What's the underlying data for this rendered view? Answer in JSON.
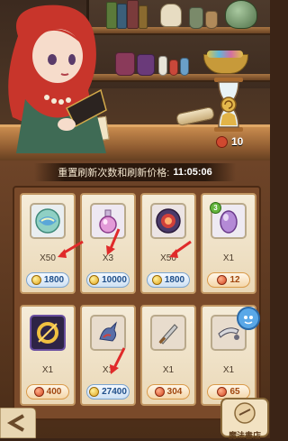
{
  "header": {
    "refresh_label": "重置刷新次数和刷新价格:",
    "refresh_time": "11:05:06",
    "refresh_count": "10"
  },
  "items": [
    {
      "name": "swirl-orb",
      "qty": "X50",
      "price": "1800",
      "currency": "coin"
    },
    {
      "name": "potion-flask",
      "qty": "X3",
      "price": "10000",
      "currency": "coin"
    },
    {
      "name": "red-rune-orb",
      "qty": "X50",
      "price": "1800",
      "currency": "coin"
    },
    {
      "name": "purple-egg",
      "qty": "X1",
      "price": "12",
      "currency": "gem",
      "badge": "3"
    },
    {
      "name": "golden-ring",
      "qty": "X1",
      "price": "400",
      "currency": "gem"
    },
    {
      "name": "dragon-figure",
      "qty": "X1",
      "price": "27400",
      "currency": "coin"
    },
    {
      "name": "dagger-weapon",
      "qty": "X1",
      "price": "304",
      "currency": "gem"
    },
    {
      "name": "silver-blade",
      "qty": "X1",
      "price": "65",
      "currency": "gem"
    }
  ],
  "footer": {
    "shop_label": "魔法書店"
  },
  "colors": {
    "coin_price": "#1f4f8a",
    "gem_price": "#a0460e",
    "arrow": "#e02a2a"
  }
}
